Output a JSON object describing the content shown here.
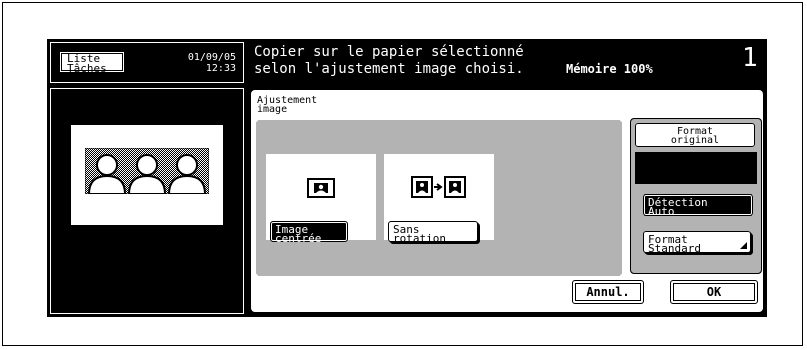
{
  "header": {
    "tasks_button_line1": "Liste",
    "tasks_button_line2": "Tâches",
    "date": "01/09/05",
    "time": "12:33",
    "message_line1": "Copier sur le papier sélectionné",
    "message_line2": "selon l'ajustement image choisi.",
    "memory": "Mémoire 100%",
    "copies": "1"
  },
  "panel": {
    "title_line1": "Ajustement",
    "title_line2": "image",
    "centered_button_line1": "Image",
    "centered_button_line2": "centrée",
    "centered_selected": true,
    "no_rotation_button_line1": "Sans",
    "no_rotation_button_line2": "rotation",
    "original_format_line1": "Format",
    "original_format_line2": "original",
    "auto_detect_line1": "Détection",
    "auto_detect_line2": "Auto",
    "standard_format_line1": "Format",
    "standard_format_line2": "Standard"
  },
  "footer": {
    "cancel_label": "Annul.",
    "ok_label": "OK"
  },
  "icons": {
    "preview": "people-preview-icon",
    "centered": "centered-image-icon",
    "no_rotation": "no-rotation-icon",
    "corner": "corner-arrow-icon"
  }
}
